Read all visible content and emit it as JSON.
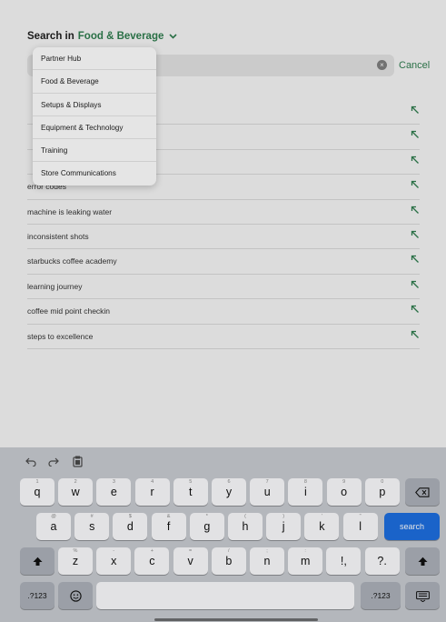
{
  "header": {
    "prefix": "Search in",
    "category": "Food & Beverage",
    "cancel_label": "Cancel"
  },
  "dropdown": {
    "items": [
      "Partner Hub",
      "Food & Beverage",
      "Setups & Displays",
      "Equipment & Technology",
      "Training",
      "Store Communications"
    ]
  },
  "suggestions": [
    "",
    "",
    "",
    "error codes",
    "machine is leaking water",
    "inconsistent shots",
    "starbucks coffee academy",
    "learning journey",
    "coffee mid point checkin",
    "steps to excellence"
  ],
  "keyboard": {
    "row1": [
      {
        "k": "q",
        "s": "1"
      },
      {
        "k": "w",
        "s": "2"
      },
      {
        "k": "e",
        "s": "3"
      },
      {
        "k": "r",
        "s": "4"
      },
      {
        "k": "t",
        "s": "5"
      },
      {
        "k": "y",
        "s": "6"
      },
      {
        "k": "u",
        "s": "7"
      },
      {
        "k": "i",
        "s": "8"
      },
      {
        "k": "o",
        "s": "9"
      },
      {
        "k": "p",
        "s": "0"
      }
    ],
    "row2": [
      {
        "k": "a",
        "s": "@"
      },
      {
        "k": "s",
        "s": "#"
      },
      {
        "k": "d",
        "s": "$"
      },
      {
        "k": "f",
        "s": "&"
      },
      {
        "k": "g",
        "s": "*"
      },
      {
        "k": "h",
        "s": "("
      },
      {
        "k": "j",
        "s": ")"
      },
      {
        "k": "k",
        "s": "'"
      },
      {
        "k": "l",
        "s": "\""
      }
    ],
    "row3": [
      {
        "k": "z",
        "s": "%"
      },
      {
        "k": "x",
        "s": "-"
      },
      {
        "k": "c",
        "s": "+"
      },
      {
        "k": "v",
        "s": "="
      },
      {
        "k": "b",
        "s": "/"
      },
      {
        "k": "n",
        "s": ";"
      },
      {
        "k": "m",
        "s": ":"
      },
      {
        "k": "!,",
        "s": ""
      },
      {
        "k": "?.",
        "s": ""
      }
    ],
    "search_label": "search",
    "numbers_label": ".?123",
    "icons": [
      "undo-icon",
      "redo-icon",
      "paste-icon",
      "delete-icon",
      "shift-icon",
      "emoji-icon",
      "keyboard-hide-icon"
    ]
  },
  "colors": {
    "accent": "#2f7d4f",
    "search_key": "#1e6fe0"
  }
}
